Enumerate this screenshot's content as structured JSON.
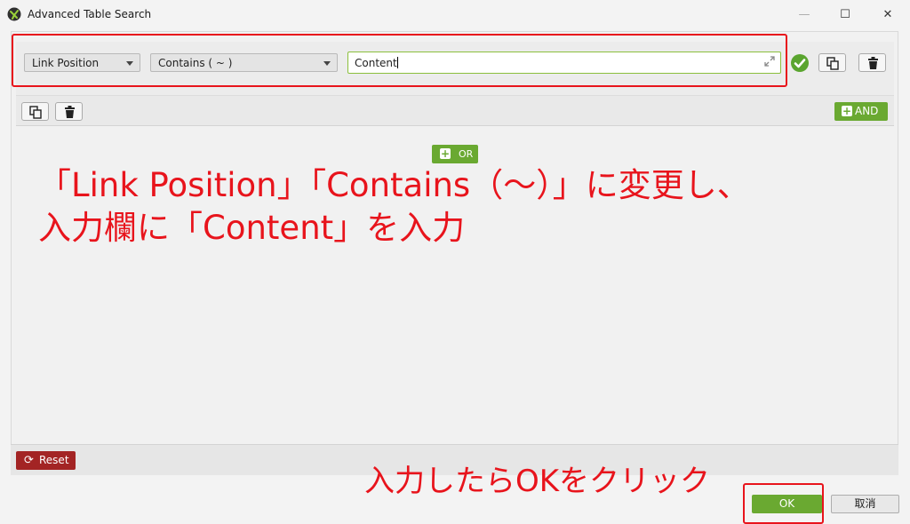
{
  "window": {
    "title": "Advanced Table Search",
    "minimize_glyph": "—",
    "maximize_glyph": "☐",
    "close_glyph": "✕"
  },
  "criteria": {
    "field_value": "Link Position",
    "operator_value": "Contains ( ~ )",
    "input_value": "Content"
  },
  "group": {
    "and_label": "AND",
    "or_label": "OR"
  },
  "footer": {
    "reset_label": "Reset",
    "ok_label": "OK",
    "cancel_label": "取消"
  },
  "annotations": {
    "line1": "「Link Position」「Contains（～）」に変更し、",
    "line2": "入力欄に「Content」を入力",
    "ok_hint": "入力したらOKをクリック"
  },
  "colors": {
    "accent_green": "#6aa931",
    "danger_red": "#a32424",
    "annotation_red": "#e8141c"
  },
  "icons": {
    "app": "app-icon",
    "check": "check-circle-icon",
    "copy": "copy-icon",
    "delete": "trash-icon",
    "expand": "expand-icon",
    "reset": "refresh-icon",
    "add": "plus-icon"
  }
}
